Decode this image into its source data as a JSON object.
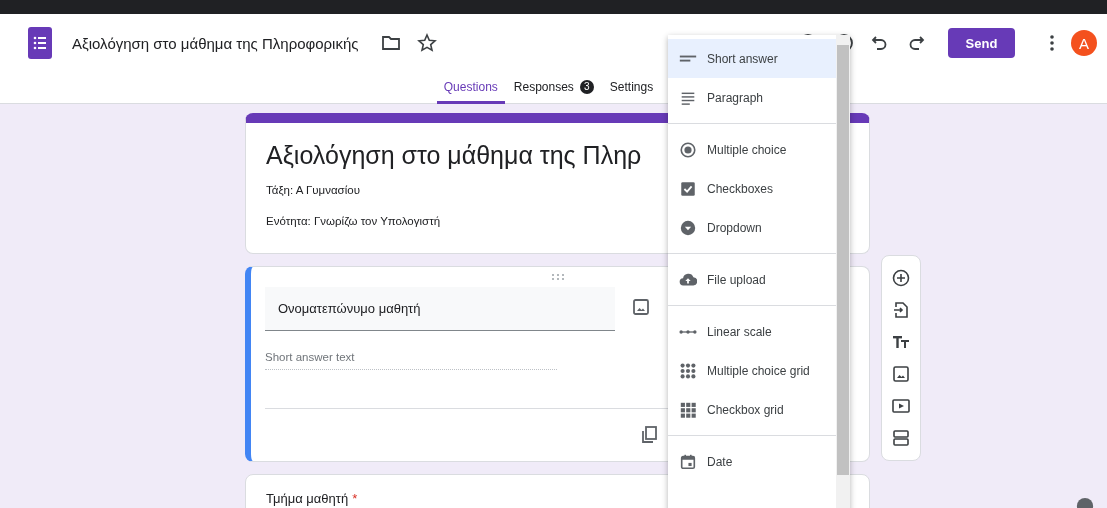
{
  "header": {
    "title": "Αξιολόγηση στο μάθημα της Πληροφορικής",
    "send": "Send",
    "avatar": "A"
  },
  "tabs": [
    {
      "label": "Questions",
      "selected": true
    },
    {
      "label": "Responses",
      "selected": false,
      "badge": "3"
    },
    {
      "label": "Settings",
      "selected": false
    }
  ],
  "form_header": {
    "title": "Αξιολόγηση στο μάθημα της Πληρ",
    "lines": [
      "Τάξη: Α Γυμνασίου",
      "Ενότητα: Γνωρίζω τον Υπολογιστή"
    ]
  },
  "question": {
    "title": "Ονοματεπώνυμο μαθητή",
    "placeholder": "Short answer text"
  },
  "next_question": {
    "title": "Τμήμα μαθητή",
    "required_mark": "*"
  },
  "type_menu": [
    [
      {
        "kind": "short",
        "label": "Short answer",
        "selected": true
      },
      {
        "kind": "paragraph",
        "label": "Paragraph",
        "selected": false
      }
    ],
    [
      {
        "kind": "radio",
        "label": "Multiple choice",
        "selected": false
      },
      {
        "kind": "checkbox",
        "label": "Checkboxes",
        "selected": false
      },
      {
        "kind": "dropdown",
        "label": "Dropdown",
        "selected": false
      }
    ],
    [
      {
        "kind": "upload",
        "label": "File upload",
        "selected": false
      }
    ],
    [
      {
        "kind": "scale",
        "label": "Linear scale",
        "selected": false
      },
      {
        "kind": "dotgrid",
        "label": "Multiple choice grid",
        "selected": false
      },
      {
        "kind": "boxgrid",
        "label": "Checkbox grid",
        "selected": false
      }
    ],
    [
      {
        "kind": "date",
        "label": "Date",
        "selected": false
      }
    ]
  ]
}
